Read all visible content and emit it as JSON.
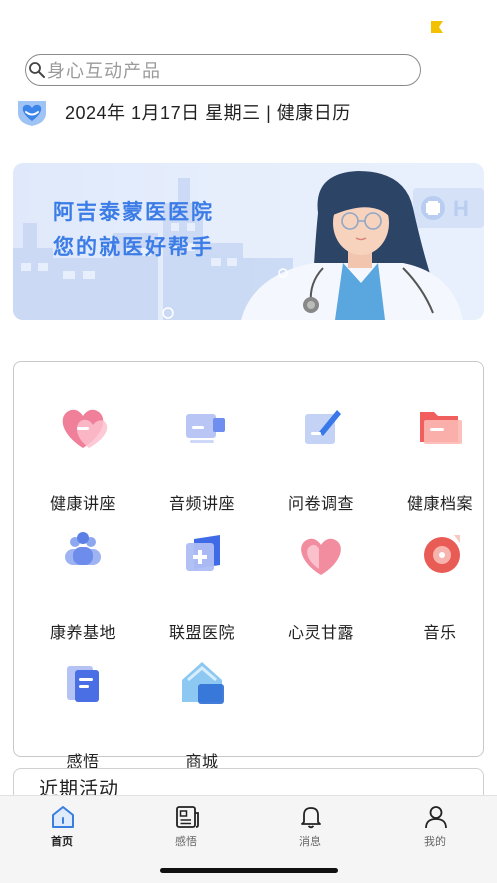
{
  "colors": {
    "accent": "#3b7ce6",
    "status_flag": "#f2c200",
    "tab_active": "#3a7fe0"
  },
  "search": {
    "placeholder": "身心互动产品"
  },
  "date_bar": {
    "icon": "heart-shield-icon",
    "text": "2024年 1月17日 星期三 | 健康日历"
  },
  "banner": {
    "line1": "阿吉泰蒙医医院",
    "line2": "您的就医好帮手"
  },
  "features": [
    {
      "label": "健康讲座",
      "icon": "heart-lecture-icon"
    },
    {
      "label": "音频讲座",
      "icon": "audio-lecture-icon"
    },
    {
      "label": "问卷调查",
      "icon": "survey-icon"
    },
    {
      "label": "健康档案",
      "icon": "health-record-icon"
    },
    {
      "label": "康养基地",
      "icon": "wellness-base-icon"
    },
    {
      "label": "联盟医院",
      "icon": "alliance-hospital-icon"
    },
    {
      "label": "心灵甘露",
      "icon": "soul-heart-icon"
    },
    {
      "label": "音乐",
      "icon": "music-disc-icon"
    },
    {
      "label": "感悟",
      "icon": "insight-book-icon"
    },
    {
      "label": "商城",
      "icon": "mall-home-icon"
    }
  ],
  "recent": {
    "title": "近期活动"
  },
  "tabs": [
    {
      "label": "首页",
      "icon": "home-icon",
      "active": true
    },
    {
      "label": "感悟",
      "icon": "news-icon",
      "active": false
    },
    {
      "label": "消息",
      "icon": "bell-icon",
      "active": false
    },
    {
      "label": "我的",
      "icon": "person-icon",
      "active": false
    }
  ]
}
